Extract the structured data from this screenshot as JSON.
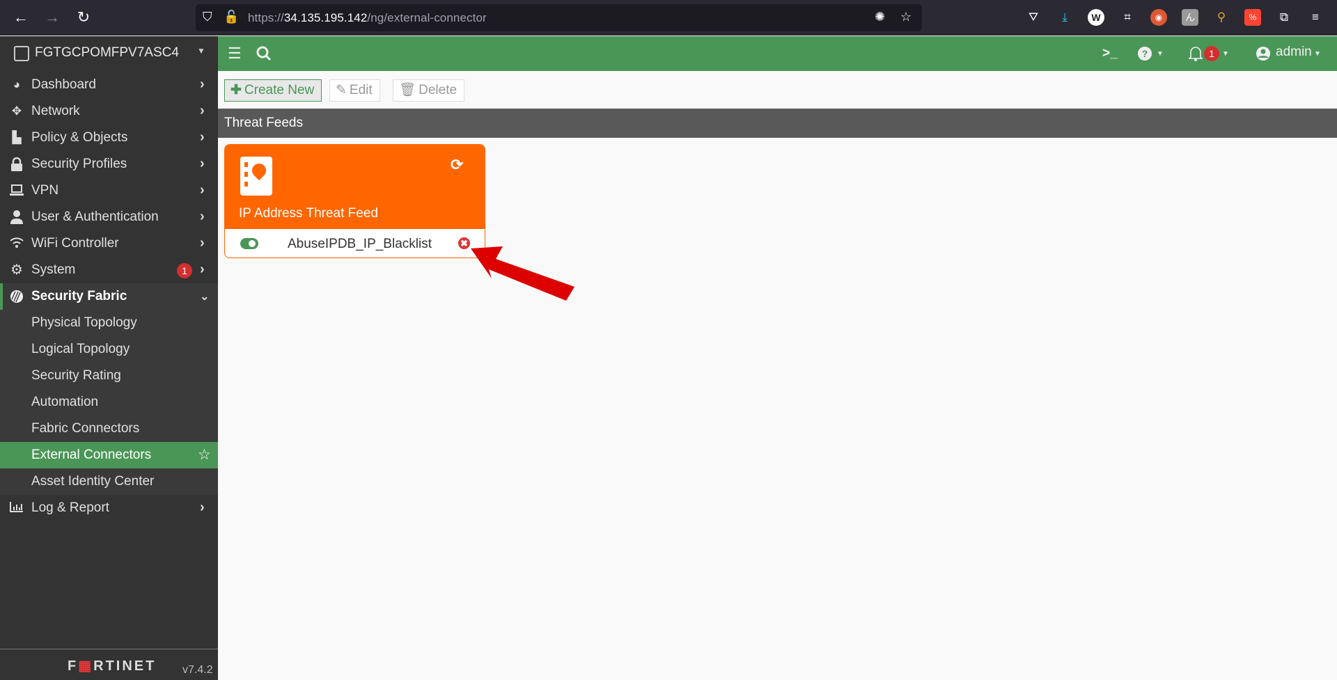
{
  "browser": {
    "url_prefix": "https://",
    "url_host": "34.135.195.142",
    "url_path": "/ng/external-connector",
    "icons": [
      "back-icon",
      "forward-icon",
      "reload-icon",
      "shield-icon",
      "insecure-lock-icon",
      "bug-icon",
      "bookmark-star-icon",
      "pocket-icon",
      "download-icon",
      "wikipedia-icon",
      "crop-icon",
      "duckduckgo-icon",
      "kanji-icon",
      "broom-icon",
      "translate-icon",
      "extensions-icon",
      "menu-icon"
    ]
  },
  "sidebar": {
    "device_name": "FGTGCPOMFPV7ASC4",
    "items": [
      {
        "label": "Dashboard",
        "icon": "dashboard-icon",
        "glyph": "◕"
      },
      {
        "label": "Network",
        "icon": "network-icon",
        "glyph": "✥"
      },
      {
        "label": "Policy & Objects",
        "icon": "policy-icon",
        "glyph": "▙"
      },
      {
        "label": "Security Profiles",
        "icon": "lock-icon",
        "glyph": "🔒"
      },
      {
        "label": "VPN",
        "icon": "laptop-icon",
        "glyph": "💻"
      },
      {
        "label": "User & Authentication",
        "icon": "user-icon",
        "glyph": "👤"
      },
      {
        "label": "WiFi Controller",
        "icon": "wifi-icon",
        "glyph": "⌔"
      },
      {
        "label": "System",
        "icon": "gear-icon",
        "glyph": "⚙",
        "badge": "1"
      },
      {
        "label": "Security Fabric",
        "icon": "fabric-icon",
        "glyph": "◍"
      },
      {
        "label": "Log & Report",
        "icon": "chart-icon",
        "glyph": "▥"
      }
    ],
    "submenu": [
      "Physical Topology",
      "Logical Topology",
      "Security Rating",
      "Automation",
      "Fabric Connectors",
      "External Connectors",
      "Asset Identity Center"
    ],
    "selected": "External Connectors",
    "brand": {
      "pre": "F",
      "mid": "▦",
      "post": "RTINET"
    },
    "version": "v7.4.2"
  },
  "header": {
    "user": "admin",
    "notification_count": "1"
  },
  "toolbar": {
    "create_new": "Create New",
    "edit": "Edit",
    "delete": "Delete"
  },
  "main": {
    "section_title": "Threat Feeds",
    "card": {
      "title": "IP Address Threat Feed",
      "color": "#ff6600",
      "feed": {
        "name": "AbuseIPDB_IP_Blacklist",
        "enabled": true
      }
    }
  },
  "colors": {
    "accent": "#4a9657",
    "orange": "#ff6600",
    "badge": "#d32f2f",
    "annotation_arrow": "#dd0000"
  }
}
